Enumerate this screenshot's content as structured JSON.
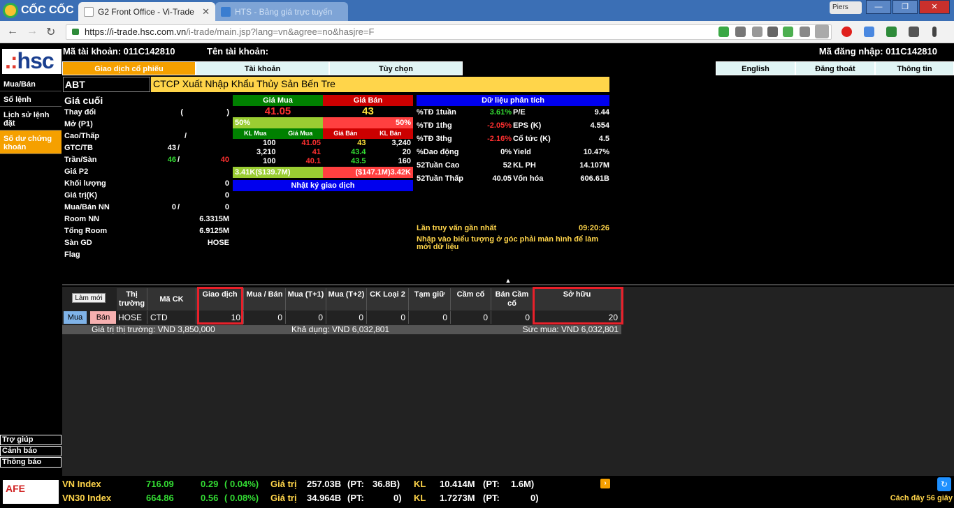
{
  "browser": {
    "brand": "CỐC CỐC",
    "tabs": [
      {
        "label": "G2 Front Office - Vi-Trade"
      },
      {
        "label": "HTS - Bảng giá trực tuyến"
      }
    ],
    "profile": "Piers",
    "url_domain": "https://i-trade.hsc.com.vn",
    "url_path": "/i-trade/main.jsp?lang=vn&agree=no&hasjre=F"
  },
  "header": {
    "logo": "hsc",
    "account_label": "Mã tài khoản: 011C142810",
    "account_name_label": "Tên tài khoản:",
    "login_label": "Mã đăng nhập: 011C142810"
  },
  "main_tabs": [
    "Giao dịch cổ phiếu",
    "Tài khoản",
    "Tùy chọn"
  ],
  "right_tabs": [
    "English",
    "Đăng thoát",
    "Thông tin"
  ],
  "sidebar": {
    "items": [
      {
        "label": "Mua/Bán"
      },
      {
        "label": "Sổ lệnh"
      },
      {
        "label": "Lịch sử lệnh đặt"
      },
      {
        "label": "Số dư chứng khoán"
      }
    ],
    "bottom": [
      "Trợ giúp",
      "Cảnh báo",
      "Thông báo"
    ]
  },
  "stock": {
    "symbol": "ABT",
    "company": "CTCP Xuất Nhập Khẩu Thủy Sản Bến Tre",
    "info": [
      {
        "label": "Giá cuối",
        "v1": "",
        "v2": "",
        "v3": ""
      },
      {
        "label": "Thay đổi",
        "v1": "(",
        "v2": "",
        "v3": ")"
      },
      {
        "label": "Mở (P1)",
        "v1": "",
        "v2": "",
        "v3": ""
      },
      {
        "label": "Cao/Thấp",
        "v1": "/",
        "v2": "",
        "v3": ""
      },
      {
        "label": "GTC/TB",
        "v1": "43",
        "v2": "/",
        "v3": ""
      },
      {
        "label": "Trần/Sàn",
        "v1": "46",
        "v2": "/",
        "v3": "40"
      },
      {
        "label": "Giá P2",
        "v1": "",
        "v2": "",
        "v3": ""
      },
      {
        "label": "Khối lượng",
        "v1": "",
        "v2": "",
        "v3": "0"
      },
      {
        "label": "Giá trị(K)",
        "v1": "",
        "v2": "",
        "v3": "0"
      },
      {
        "label": "Mua/Bán NN",
        "v1": "0",
        "v2": "/",
        "v3": "0"
      },
      {
        "label": "Room NN",
        "v1": "",
        "v2": "",
        "v3": "6.3315M"
      },
      {
        "label": "Tổng Room",
        "v1": "",
        "v2": "",
        "v3": "6.9125M"
      },
      {
        "label": "Sàn GD",
        "v1": "",
        "v2": "",
        "v3": "HOSE"
      },
      {
        "label": "Flag",
        "v1": "",
        "v2": "",
        "v3": ""
      }
    ]
  },
  "book": {
    "buy_label": "Giá Mua",
    "sell_label": "Giá Bán",
    "buy_price": "41.05",
    "sell_price": "43",
    "buy_pct": "50%",
    "sell_pct": "50%",
    "cols": [
      "KL Mua",
      "Giá Mua",
      "Giá Bán",
      "KL Bán"
    ],
    "rows": [
      [
        "100",
        "41.05",
        "43",
        "3,240"
      ],
      [
        "3,210",
        "41",
        "43.4",
        "20"
      ],
      [
        "100",
        "40.1",
        "43.5",
        "160"
      ]
    ],
    "buy_vol": "3.41K($139.7M)",
    "sell_vol": "($147.1M)3.42K",
    "journal": "Nhật ký giao dịch"
  },
  "analysis": {
    "title": "Dữ liệu phân tích",
    "rows": [
      {
        "k": "%TĐ 1tuần",
        "v": "3.61%",
        "k2": "P/E",
        "v2": "9.44"
      },
      {
        "k": "%TĐ 1thg",
        "v": "-2.05%",
        "k2": "EPS (K)",
        "v2": "4.554"
      },
      {
        "k": "%TĐ 3thg",
        "v": "-2.16%",
        "k2": "Cổ tức (K)",
        "v2": "4.5"
      },
      {
        "k": "%Dao động",
        "v": "0%",
        "k2": "Yield",
        "v2": "10.47%"
      },
      {
        "k": "52Tuần Cao",
        "v": "52",
        "k2": "KL PH",
        "v2": "14.107M"
      },
      {
        "k": "52Tuần Thấp",
        "v": "40.05",
        "k2": "Vốn hóa",
        "v2": "606.61B"
      }
    ],
    "last_query_label": "Lần truy vấn gần nhất",
    "last_query_time": "09:20:26",
    "hint": "Nhập vào biểu tượng ở góc phải màn hình để làm mới dữ liệu"
  },
  "portfolio": {
    "refresh": "Làm mới",
    "headers": [
      "Thị trường",
      "Mã CK",
      "Giao dịch",
      "Mua / Bán",
      "Mua (T+1)",
      "Mua (T+2)",
      "CK Loại 2",
      "Tạm giữ",
      "Cầm cố",
      "Bán Cầm cố",
      "Sở hữu"
    ],
    "buy_btn": "Mua",
    "sell_btn": "Bán",
    "row": [
      "HOSE",
      "CTD",
      "10",
      "0",
      "0",
      "0",
      "0",
      "0",
      "0",
      "0",
      "20"
    ],
    "market_value": "Giá trị thị trường: VND 3,850,000",
    "available": "Khả dụng: VND 6,032,801",
    "purchasing": "Sức mua: VND 6,032,801"
  },
  "index": {
    "rows": [
      {
        "name": "VN Index",
        "val": "716.09",
        "chg": "0.29",
        "pct": "( 0.04%)",
        "gt_label": "Giá trị",
        "gt": "257.03B",
        "pt1": "(PT:",
        "pt1v": "36.8B)",
        "kl_label": "KL",
        "kl": "10.414M",
        "pt2": "(PT:",
        "pt2v": "1.6M)"
      },
      {
        "name": "VN30 Index",
        "val": "664.86",
        "chg": "0.56",
        "pct": "( 0.08%)",
        "gt_label": "Giá trị",
        "gt": "34.964B",
        "pt1": "(PT:",
        "pt1v": "0)",
        "kl_label": "KL",
        "kl": "1.7273M",
        "pt2": "(PT:",
        "pt2v": "0)"
      }
    ],
    "updated": "Cách đây 56 giây"
  },
  "colors": {
    "accent": "#f5a000",
    "buy": "#008000",
    "sell": "#cc0000",
    "highlight": "#e8202a"
  }
}
